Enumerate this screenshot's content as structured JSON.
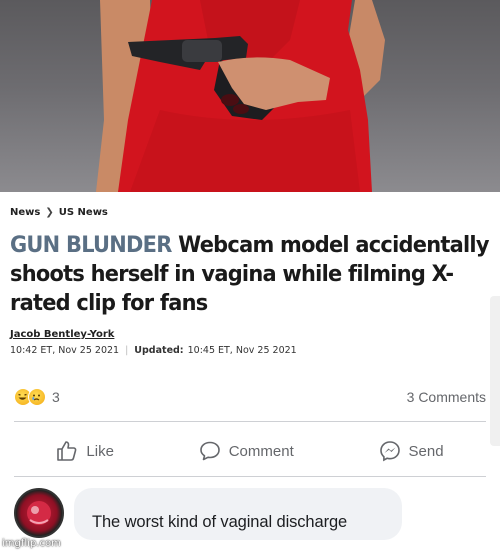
{
  "article": {
    "breadcrumb": {
      "section": "News",
      "subsection": "US News"
    },
    "headline_kicker": "GUN BLUNDER",
    "headline_text": " Webcam model accidentally shoots herself in vagina while filming X-rated clip for fans",
    "author": "Jacob Bentley-York",
    "published": "10:42 ET, Nov 25 2021",
    "updated_label": "Updated:",
    "updated": "10:45 ET, Nov 25 2021"
  },
  "post": {
    "reaction_icons": [
      "laughing-emoji-icon",
      "sad-emoji-icon"
    ],
    "reaction_count": "3",
    "comments_count": "3 Comments",
    "actions": {
      "like": "Like",
      "comment": "Comment",
      "send": "Send"
    }
  },
  "comment": {
    "avatar_icon": "avatar",
    "text": "The worst kind of vaginal discharge"
  },
  "watermark": "imgflip.com",
  "colors": {
    "kicker": "#5a6f84",
    "dress": "#d2141e",
    "muted": "#65676b",
    "bubble": "#f0f2f5"
  }
}
